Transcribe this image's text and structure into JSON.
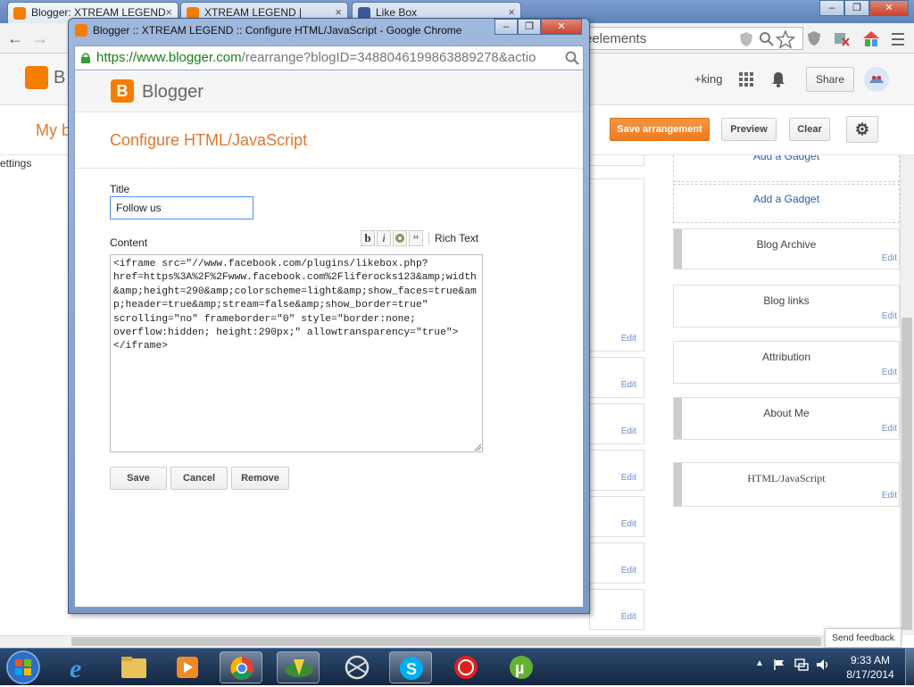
{
  "browser": {
    "tabs": [
      {
        "label": "Blogger: XTREAM LEGEND",
        "close": "×"
      },
      {
        "label": "XTREAM LEGEND |",
        "close": "×"
      },
      {
        "label": "Like Box",
        "close": "×"
      }
    ],
    "address_partial": "eelements",
    "window_controls": {
      "min": "–",
      "max": "❐",
      "close": "✕"
    }
  },
  "background_page": {
    "logo_partial": "B",
    "user": "+king",
    "share_label": "Share",
    "my_partial": "My b",
    "settings_partial": "ettings",
    "save_arrangement": "Save arrangement",
    "preview": "Preview",
    "clear": "Clear",
    "add_gadget_top": "Add a Gadget",
    "add_gadget": "Add a Gadget",
    "right_widgets": [
      {
        "title": "Blog Archive",
        "edit": "Edit"
      },
      {
        "title": "Blog links",
        "edit": "Edit"
      },
      {
        "title": "Attribution",
        "edit": "Edit"
      },
      {
        "title": "About Me",
        "edit": "Edit"
      },
      {
        "title": "HTML/JavaScript",
        "edit": "Edit"
      }
    ],
    "mid_edit": "Edit",
    "send_feedback": "Send feedback"
  },
  "popup": {
    "window_title": "Blogger :: XTREAM LEGEND :: Configure HTML/JavaScript - Google Chrome",
    "url_host": "https://www.blogger.com",
    "url_path": "/rearrange?blogID=3488046199863889278&actio",
    "logo_text": "Blogger",
    "heading": "Configure HTML/JavaScript",
    "title_label": "Title",
    "title_value": "Follow us",
    "content_label": "Content",
    "rich_text": "Rich Text",
    "content_value": "<iframe src=\"//www.facebook.com/plugins/likebox.php?href=https%3A%2F%2Fwww.facebook.com%2Fliferocks123&amp;width&amp;height=290&amp;colorscheme=light&amp;show_faces=true&amp;header=true&amp;stream=false&amp;show_border=true\" scrolling=\"no\" frameborder=\"0\" style=\"border:none; overflow:hidden; height:290px;\" allowtransparency=\"true\"></iframe>",
    "save": "Save",
    "cancel": "Cancel",
    "remove": "Remove"
  },
  "taskbar": {
    "time": "9:33 AM",
    "date": "8/17/2014"
  },
  "colors": {
    "blogger_orange": "#f57d00",
    "heading_orange": "#e0772f",
    "link_blue": "#2a5db0"
  }
}
